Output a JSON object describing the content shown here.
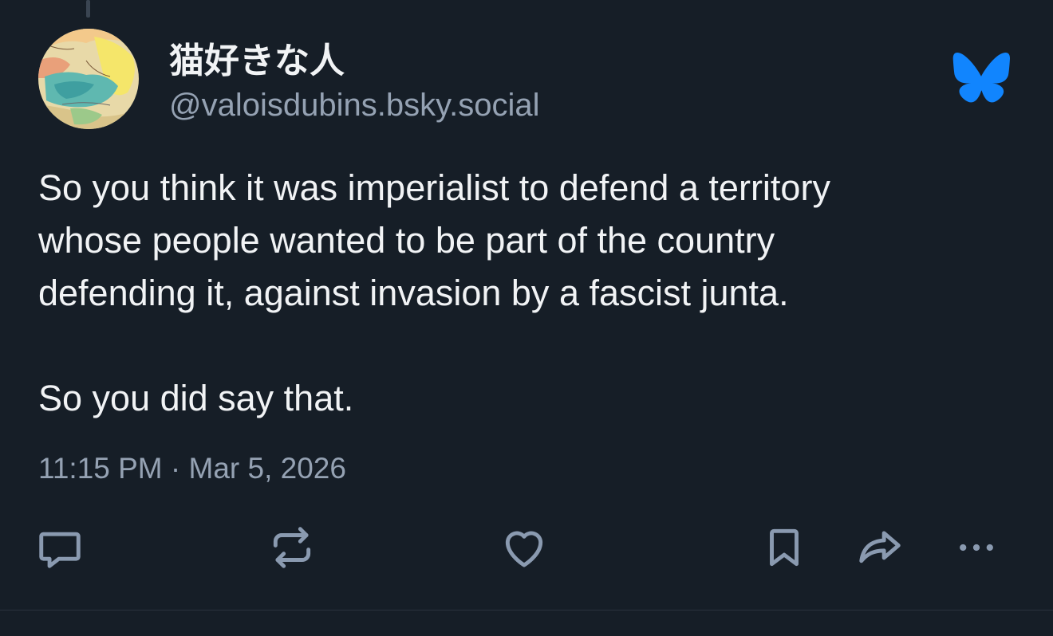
{
  "post": {
    "display_name": "猫好きな人",
    "handle": "@valoisdubins.bsky.social",
    "text": "So you think it was imperialist to defend a territory\nwhose people wanted to be part of the country\ndefending it, against invasion by a fascist junta.\n\nSo you did say that.",
    "timestamp": "11:15 PM · Mar 5, 2026"
  },
  "icons": {
    "avatar": "map-avatar",
    "brand": "bluesky-butterfly-icon",
    "actions": [
      "reply-icon",
      "repost-icon",
      "like-icon",
      "bookmark-icon",
      "share-icon",
      "more-icon"
    ]
  },
  "colors": {
    "background": "#161e27",
    "text_primary": "#f1f3f5",
    "text_secondary": "#95a2b3",
    "icon": "#8a9ab0",
    "brand_blue": "#1185fe"
  }
}
